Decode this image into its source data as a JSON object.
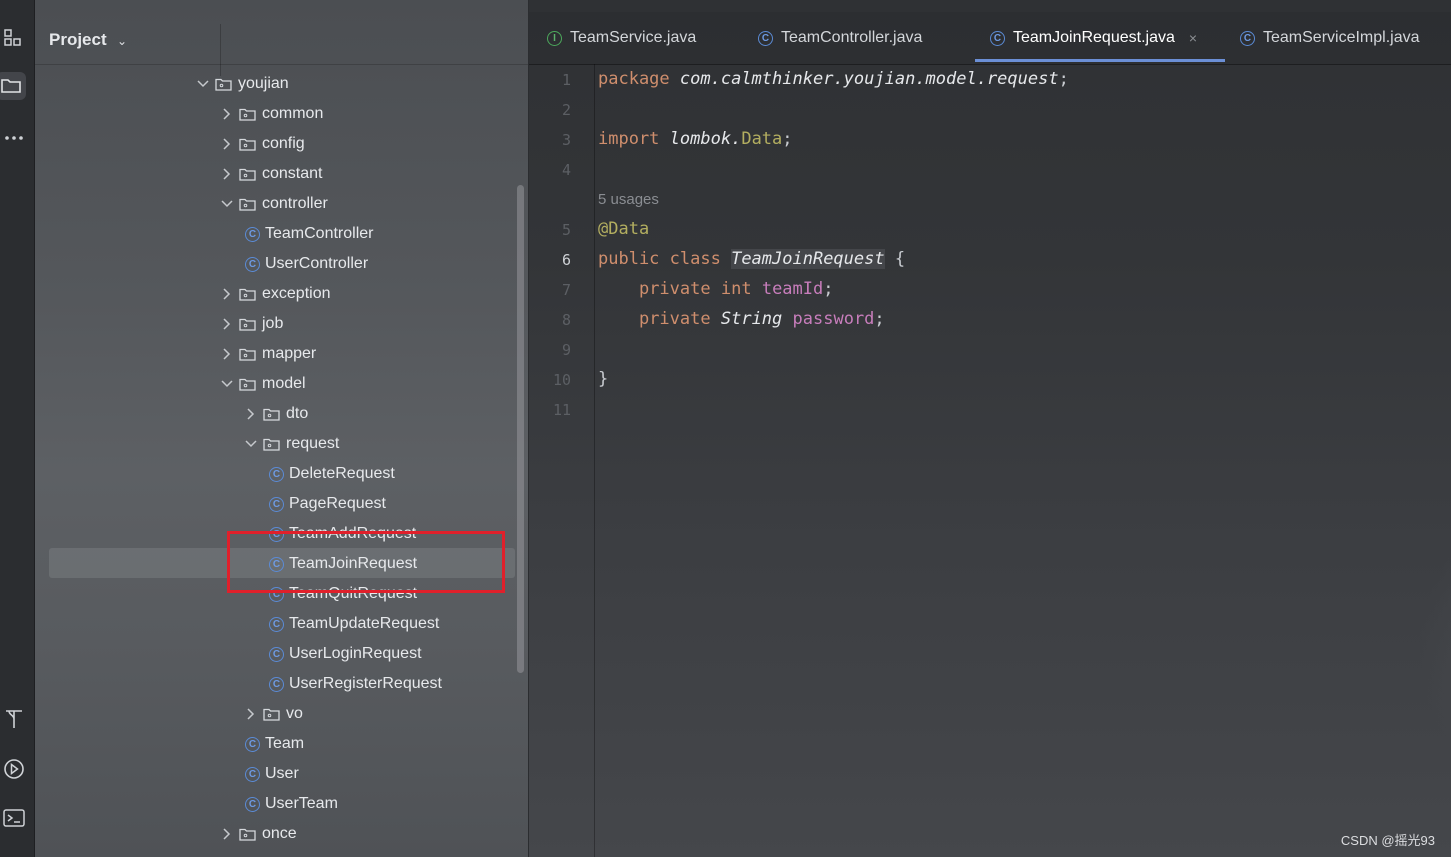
{
  "panel": {
    "title": "Project"
  },
  "tree": [
    {
      "label": "youjian",
      "type": "folder",
      "expanded": true
    },
    {
      "label": "common",
      "type": "folder",
      "expanded": false
    },
    {
      "label": "config",
      "type": "folder",
      "expanded": false
    },
    {
      "label": "constant",
      "type": "folder",
      "expanded": false
    },
    {
      "label": "controller",
      "type": "folder",
      "expanded": true
    },
    {
      "label": "TeamController",
      "type": "class"
    },
    {
      "label": "UserController",
      "type": "class"
    },
    {
      "label": "exception",
      "type": "folder",
      "expanded": false
    },
    {
      "label": "job",
      "type": "folder",
      "expanded": false
    },
    {
      "label": "mapper",
      "type": "folder",
      "expanded": false
    },
    {
      "label": "model",
      "type": "folder",
      "expanded": true
    },
    {
      "label": "dto",
      "type": "folder",
      "expanded": false
    },
    {
      "label": "request",
      "type": "folder",
      "expanded": true
    },
    {
      "label": "DeleteRequest",
      "type": "class"
    },
    {
      "label": "PageRequest",
      "type": "class"
    },
    {
      "label": "TeamAddRequest",
      "type": "class"
    },
    {
      "label": "TeamJoinRequest",
      "type": "class",
      "selected": true
    },
    {
      "label": "TeamQuitRequest",
      "type": "class"
    },
    {
      "label": "TeamUpdateRequest",
      "type": "class"
    },
    {
      "label": "UserLoginRequest",
      "type": "class"
    },
    {
      "label": "UserRegisterRequest",
      "type": "class"
    },
    {
      "label": "vo",
      "type": "folder",
      "expanded": false
    },
    {
      "label": "Team",
      "type": "class"
    },
    {
      "label": "User",
      "type": "class"
    },
    {
      "label": "UserTeam",
      "type": "class"
    },
    {
      "label": "once",
      "type": "folder",
      "expanded": false
    }
  ],
  "tabs": [
    {
      "label": "TeamService.java",
      "icon": "interface-icon",
      "icon_letter": "I"
    },
    {
      "label": "TeamController.java",
      "icon": "class-icon",
      "icon_letter": "C"
    },
    {
      "label": "TeamJoinRequest.java",
      "icon": "class-icon",
      "icon_letter": "C",
      "active": true,
      "close": "×"
    },
    {
      "label": "TeamServiceImpl.java",
      "icon": "class-icon",
      "icon_letter": "C"
    }
  ],
  "editor": {
    "line_numbers": [
      "1",
      "2",
      "3",
      "4",
      "5",
      "6",
      "7",
      "8",
      "9",
      "10",
      "11"
    ],
    "usages_hint": "5 usages",
    "code": {
      "l1_kw": "package",
      "l1_pkg": "com.calmthinker.youjian.model.request",
      "l1_end": ";",
      "l3_kw": "import",
      "l3_pkg": "lombok.",
      "l3_cls": "Data",
      "l3_end": ";",
      "l5_ann": "@Data",
      "l6_kw": "public class",
      "l6_name": "TeamJoinRequest",
      "l6_brace": "{",
      "l7_kw": "private",
      "l7_type": "int",
      "l7_field": "teamId",
      "l7_end": ";",
      "l8_kw": "private",
      "l8_type": "String",
      "l8_field": "password",
      "l8_end": ";",
      "l10_brace": "}"
    }
  },
  "watermark": "CSDN @摇光93",
  "colors": {
    "highlight_box": "#e0202b",
    "keyword": "#cf8e6d",
    "annotation": "#b3ae60",
    "field": "#c77dbb"
  }
}
